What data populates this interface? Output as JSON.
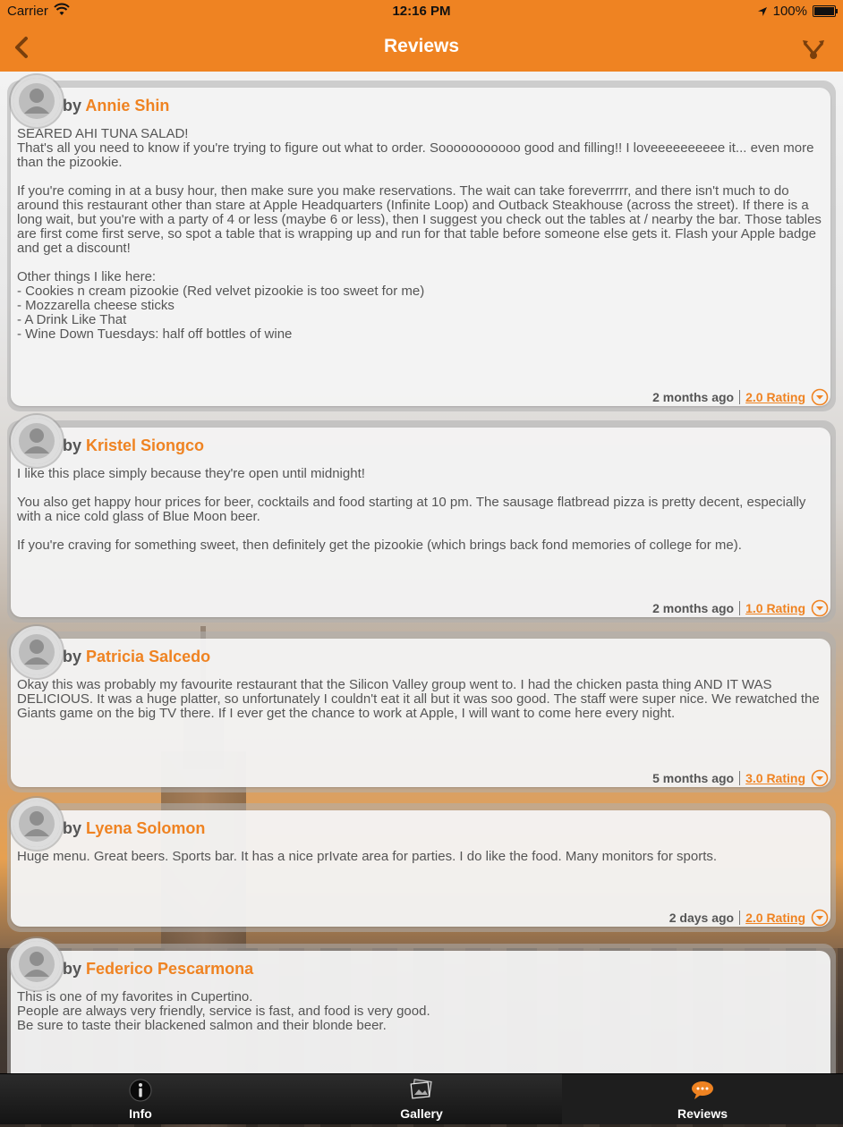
{
  "status_bar": {
    "carrier": "Carrier",
    "time": "12:16 PM",
    "battery": "100%"
  },
  "nav": {
    "title": "Reviews",
    "back_icon": "chevron-left-icon",
    "share_icon": "share-icon"
  },
  "colors": {
    "accent": "#ef8322"
  },
  "reviews": [
    {
      "by": "by",
      "author": "Annie Shin",
      "body": "SEARED AHI TUNA SALAD!\nThat's all you need to know if you're trying to figure out what to order. Sooooooooooo good and filling!! I loveeeeeeeeee it... even more than the pizookie.\n\nIf you're coming in at a busy hour, then make sure you make reservations. The wait can take foreverrrrr, and there isn't much to do around this restaurant other than stare at Apple Headquarters (Infinite Loop) and Outback Steakhouse (across the street). If there is a long wait, but you're with a party of 4 or less (maybe 6 or less), then I suggest you check out the tables at / nearby the bar. Those tables are first come first serve, so spot a table that is wrapping up and run for that table before someone else gets it. Flash your Apple badge and get a discount!\n\nOther things I like here:\n- Cookies n cream pizookie (Red velvet pizookie is too sweet for me)\n- Mozzarella cheese sticks\n- A Drink Like That\n- Wine Down Tuesdays: half off bottles of wine",
      "time_ago": "2 months ago",
      "rating": "2.0 Rating"
    },
    {
      "by": "by",
      "author": "Kristel Siongco",
      "body": "I like this place simply because they're open until midnight!\n\nYou also get happy hour prices for beer, cocktails and food starting at 10 pm. The sausage flatbread pizza is pretty decent, especially with a nice cold glass of Blue Moon beer.\n\nIf you're craving for something sweet, then definitely get the pizookie (which brings back fond memories of college for me).",
      "time_ago": "2 months ago",
      "rating": "1.0 Rating"
    },
    {
      "by": "by",
      "author": "Patricia Salcedo",
      "body": "Okay this was probably my favourite restaurant that the Silicon Valley group went to. I had the chicken pasta thing AND IT WAS DELICIOUS. It was a huge platter, so unfortunately I couldn't eat it all but it was soo good. The staff were super nice. We rewatched the Giants game on the big TV there. If I ever get the chance to work at Apple, I will want to come here every night.",
      "time_ago": "5 months ago",
      "rating": "3.0 Rating"
    },
    {
      "by": "by",
      "author": "Lyena Solomon",
      "body": "Huge menu. Great beers. Sports bar. It has a nice prIvate area for parties.  I do like the food. Many monitors for sports.",
      "time_ago": "2 days ago",
      "rating": "2.0 Rating"
    },
    {
      "by": "by",
      "author": "Federico Pescarmona",
      "body": "This is one of my favorites in Cupertino.\nPeople are always very friendly, service is fast, and food is very good.\nBe sure to taste their blackened salmon and their blonde beer.",
      "time_ago": "",
      "rating": ""
    }
  ],
  "tabs": [
    {
      "label": "Info",
      "icon": "info-icon",
      "active": false
    },
    {
      "label": "Gallery",
      "icon": "gallery-icon",
      "active": false
    },
    {
      "label": "Reviews",
      "icon": "chat-bubble-icon",
      "active": true
    }
  ]
}
